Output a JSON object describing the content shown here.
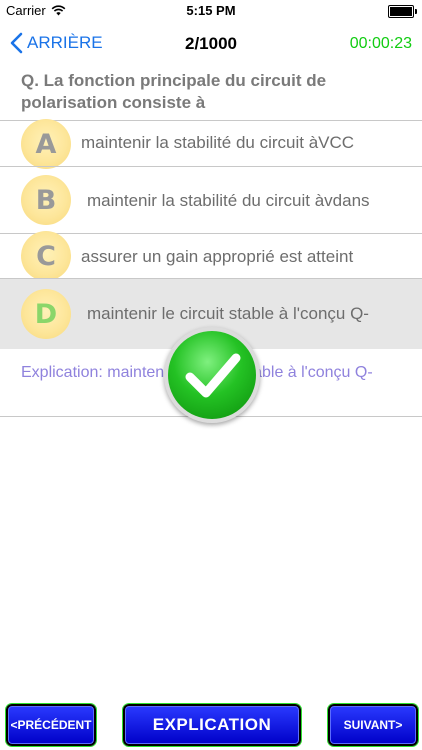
{
  "status_bar": {
    "carrier": "Carrier",
    "time": "5:15 PM",
    "wifi_icon": "wifi-icon",
    "battery_icon": "battery-icon"
  },
  "nav": {
    "back_label": "ARRIÈRE",
    "title": "2/1000",
    "timer": "00:00:23"
  },
  "question": "Q. La fonction principale du circuit de polarisation consiste à",
  "options": [
    {
      "letter": "A",
      "text": "maintenir la stabilité du circuit àVCC"
    },
    {
      "letter": "B",
      "text": "maintenir la stabilité du circuit àvdans"
    },
    {
      "letter": "C",
      "text": "assurer un gain approprié est atteint"
    },
    {
      "letter": "D",
      "text": "maintenir le circuit stable à l'conçu Q-"
    }
  ],
  "explanation": "Explication: maintenir le circuit stable à l'conçu Q-",
  "result_icon": "check-icon",
  "colors": {
    "timer": "#11cc11",
    "accent": "#1a73e8",
    "explanation": "#8f82dd",
    "button": "#0a14e6"
  },
  "buttons": {
    "previous": "<PRÉCÉDENT",
    "explanation": "EXPLICATION",
    "next": "SUIVANT>"
  }
}
